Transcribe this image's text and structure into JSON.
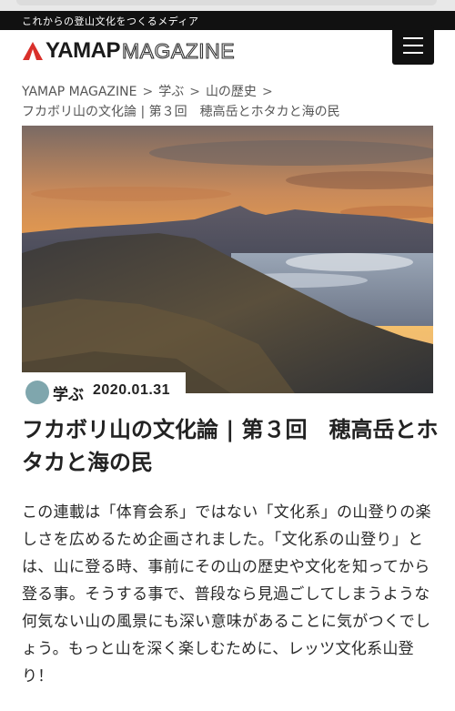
{
  "site": {
    "tagline": "これからの登山文化をつくるメディア",
    "logo_main": "YAMAP",
    "logo_sub": "MAGAZINE",
    "menu_icon": "hamburger-icon"
  },
  "breadcrumb": {
    "items": [
      "YAMAP MAGAZINE",
      "学ぶ",
      "山の歴史"
    ],
    "current": "フカボリ山の文化論 | 第３回　穂高岳とホタカと海の民",
    "separator": ">"
  },
  "article": {
    "category": "学ぶ",
    "category_icon": "category-leaf-icon",
    "date": "2020.01.31",
    "title": "フカボリ山の文化論 | 第３回　穂高岳とホタカと海の民",
    "lead": "この連載は「体育会系」ではない「文化系」の山登りの楽しさを広めるため企画されました。「文化系の山登り」とは、山に登る時、事前にその山の歴史や文化を知ってから登る事。そうする事で、普段なら見過ごしてしまうような何気ない山の風景にも深い意味があることに気がつくでしょう。もっと山を深く楽しむために、レッツ文化系山登り！"
  },
  "colors": {
    "brand_red": "#d9302b",
    "bar_black": "#111111",
    "category_icon": "#7fa6ad"
  }
}
